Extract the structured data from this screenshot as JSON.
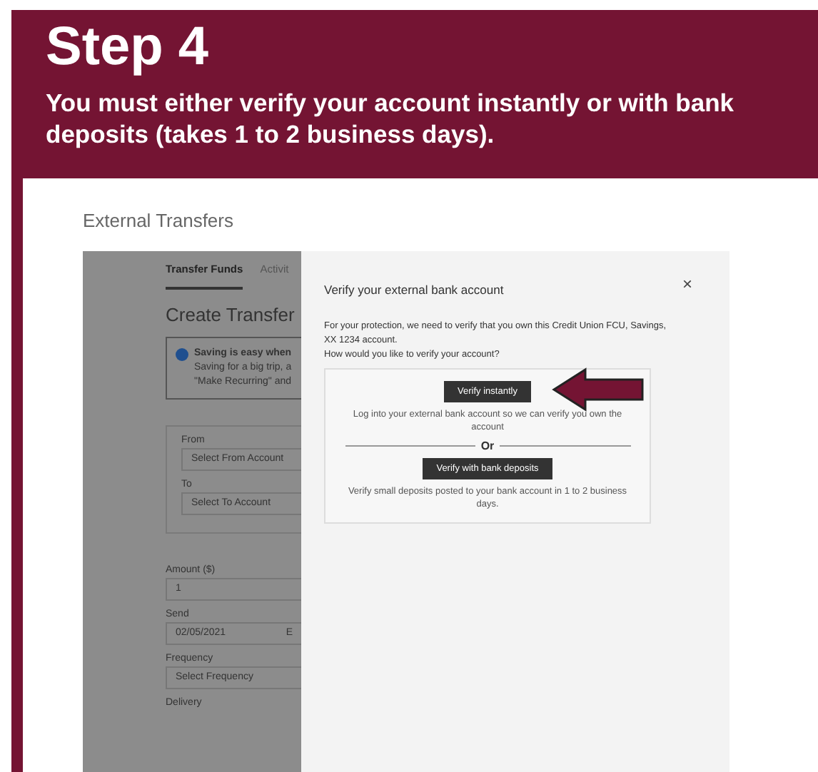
{
  "banner": {
    "title": "Step 4",
    "subtitle": "You must either verify your account instantly or with bank deposits (takes 1 to 2 business days)."
  },
  "page_title": "External Transfers",
  "background_form": {
    "tabs": [
      {
        "label": "Transfer Funds",
        "selected": true
      },
      {
        "label": "Activit",
        "selected": false
      }
    ],
    "heading": "Create Transfer",
    "info": {
      "title": "Saving is easy when",
      "lines": [
        "Saving for a big trip, a",
        "\"Make Recurring\" and"
      ]
    },
    "account_fields": [
      {
        "label": "From",
        "value": "Select From Account"
      },
      {
        "label": "To",
        "value": "Select To Account"
      }
    ],
    "fields": [
      {
        "label": "Amount ($)",
        "value": "1"
      },
      {
        "label": "Send",
        "value": "02/05/2021",
        "suffix": "E"
      },
      {
        "label": "Frequency",
        "value": "Select Frequency"
      }
    ],
    "last_label": "Delivery"
  },
  "modal": {
    "close": "×",
    "title": "Verify your external bank account",
    "intro": "For your protection, we need to verify that you own this Credit Union FCU, Savings, XX 1234 account.",
    "question": "How would you like to verify your account?",
    "options": [
      {
        "button": "Verify instantly",
        "description": "Log into your external bank account so we can verify you own the account"
      },
      {
        "button": "Verify with bank deposits",
        "description": "Verify small deposits posted to your bank account in 1 to 2 business days."
      }
    ],
    "separator": "Or"
  }
}
